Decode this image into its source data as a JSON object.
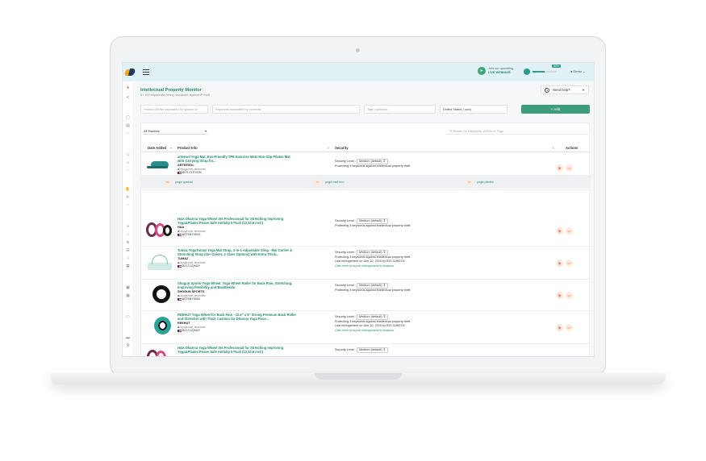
{
  "header": {
    "webinar_line1": "Join our upcoming",
    "webinar_line2": "LIVE WEBINAR",
    "progress_label": "50%",
    "progress_fraction": 0.5,
    "user_name": "Demo"
  },
  "page": {
    "title": "Intellectual Property Monitor",
    "subtitle": "8 / 100 keyword(s) being monitored against IP theft",
    "help_label": "Need help?"
  },
  "filters": {
    "asins_placeholder": "Product ASINs separated by spaces or",
    "keywords_placeholder": "Keywords separated by commas",
    "tags_placeholder": "Tags (optional)",
    "marketplace_value": "United States (.com)",
    "add_label": "+ Add"
  },
  "table": {
    "markets_value": "All Markets",
    "search_placeholder": "Search for Keywords, ASINs or Tags",
    "columns": {
      "date_added": "Date Added",
      "product_info": "Product Info",
      "security": "Security",
      "actions": "Actions"
    },
    "rows": [
      {
        "title_line1": "arteesol Yoga Mat, Eco-Friendly TPE Exercise Mats Non-Slip Pilates Mat",
        "title_line2": "with Carrying Strap for...",
        "brand": "ARTEESOL",
        "tags": "#yoga mat, #exercise",
        "asin": "B07LCHTVSM",
        "security_label": "Security Level :",
        "security_value": "Medium (default) ⇕",
        "protecting": "Protecting 3 keywords against intellectual property theft.",
        "infringement": "",
        "report": ""
      },
      {
        "title_line1": "H&A Dharma Yoga Wheel Set Professional for Stretching Improving",
        "title_line2": "Yoga&Pilates Poses Safe Antislip 3 Pack (12,10,6 inch)",
        "brand": "H&A",
        "tags": "#yoga mat, #exercise",
        "asin": "B07SBYXK63",
        "security_label": "Security Level :",
        "security_value": "Medium (default) ⇕",
        "protecting": "Protecting 3 keywords against intellectual property theft.",
        "infringement": "",
        "report": ""
      },
      {
        "title_line1": "Tumaz YogaTumaz Yoga Mat Strap, 2-in-1 Adjustable Sling - Mat Carrier &",
        "title_line2": "Stretching Strap (15+ Colors, 2 Sizes Options) with Extra Thick...",
        "brand": "TUMAZ",
        "tags": "#yoga mat, #exercise",
        "asin": "B07JJJQM2Y",
        "security_label": "Security Level :",
        "security_value": "Medium (default) ⇕",
        "protecting": "Protecting 3 keywords against intellectual property theft.",
        "infringement": "Last infringement on Dec 10, 2019 by B07JJJM72X",
        "report": "Click here to report infringement to Amazon"
      },
      {
        "title_line1": "Shogun Sports Yoga Wheel. Yoga Wheel Roller for Back Pain, Stretching,",
        "title_line2": "Improving Flexibility and Backbends.",
        "brand": "SHOGUN SPORTS",
        "tags": "#yoga mat, #exercise",
        "asin": "B07SBY5K63",
        "security_label": "Security Level :",
        "security_value": "Medium (default) ⇕",
        "protecting": "Protecting 3 keywords against intellectual property theft.",
        "infringement": "",
        "report": ""
      },
      {
        "title_line1": "REEHUT Yoga Wheel for Back Pain - 12.6\" x 5\" Strong Premium Back Roller",
        "title_line2": "and Stretcher with Thick Cushion for Dharma Yoga Pose...",
        "brand": "REEHUT",
        "tags": "#yoga mat, #exercise",
        "asin": "B07JJJQM2Y",
        "security_label": "Security Level :",
        "security_value": "Medium (default) ⇕",
        "protecting": "Protecting 3 keywords against intellectual property theft.",
        "infringement": "Last infringement on Dec 10, 2019 by B07JJJM72X",
        "report": "Click here to report infringement to Amazon"
      },
      {
        "title_line1": "H&A Dharma Yoga Wheel Set Professional for Stretching Improving",
        "title_line2": "Yoga&Pilates Poses Safe Antislip 3 Pack (12,10,6 inch)",
        "brand": "",
        "tags": "",
        "asin": "",
        "security_label": "Security Level :",
        "security_value": "Medium (default) ⇕",
        "protecting": "",
        "infringement": "",
        "report": ""
      }
    ],
    "keywords": [
      "yoga special",
      "yoga mat eco",
      "yoga pilates"
    ]
  },
  "colors": {
    "accent": "#1f8a6b",
    "topbar": "#e0f2f5",
    "add_button": "#3d9c7c",
    "action_bg": "#fde8de",
    "action_fg": "#e57a4a"
  }
}
